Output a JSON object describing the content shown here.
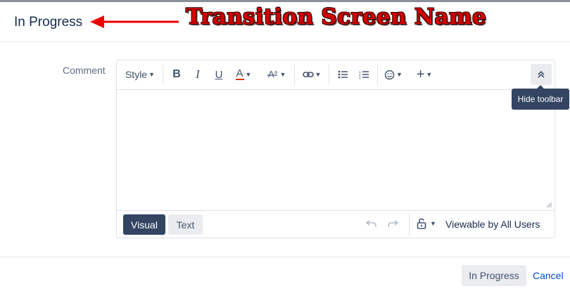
{
  "dialog": {
    "title": "In Progress"
  },
  "annotation": {
    "text": "Transition Screen Name",
    "color": "#d20000"
  },
  "form": {
    "comment_label": "Comment"
  },
  "toolbar": {
    "style_label": "Style",
    "hide_toolbar_tooltip": "Hide toolbar",
    "icons": [
      "bold-icon",
      "italic-icon",
      "underline-icon",
      "text-color-icon",
      "more-formatting-icon",
      "link-icon",
      "bullet-list-icon",
      "numbered-list-icon",
      "emoji-icon",
      "insert-more-icon",
      "collapse-toolbar-icon"
    ]
  },
  "editor": {
    "modes": {
      "visual": "Visual",
      "text": "Text"
    },
    "active_mode": "Visual",
    "visibility": "Viewable by All Users"
  },
  "actions": {
    "submit_label": "In Progress",
    "cancel_label": "Cancel"
  },
  "colors": {
    "accent": "#344563",
    "link": "#0052cc",
    "text_color_underline": "#de350b"
  }
}
